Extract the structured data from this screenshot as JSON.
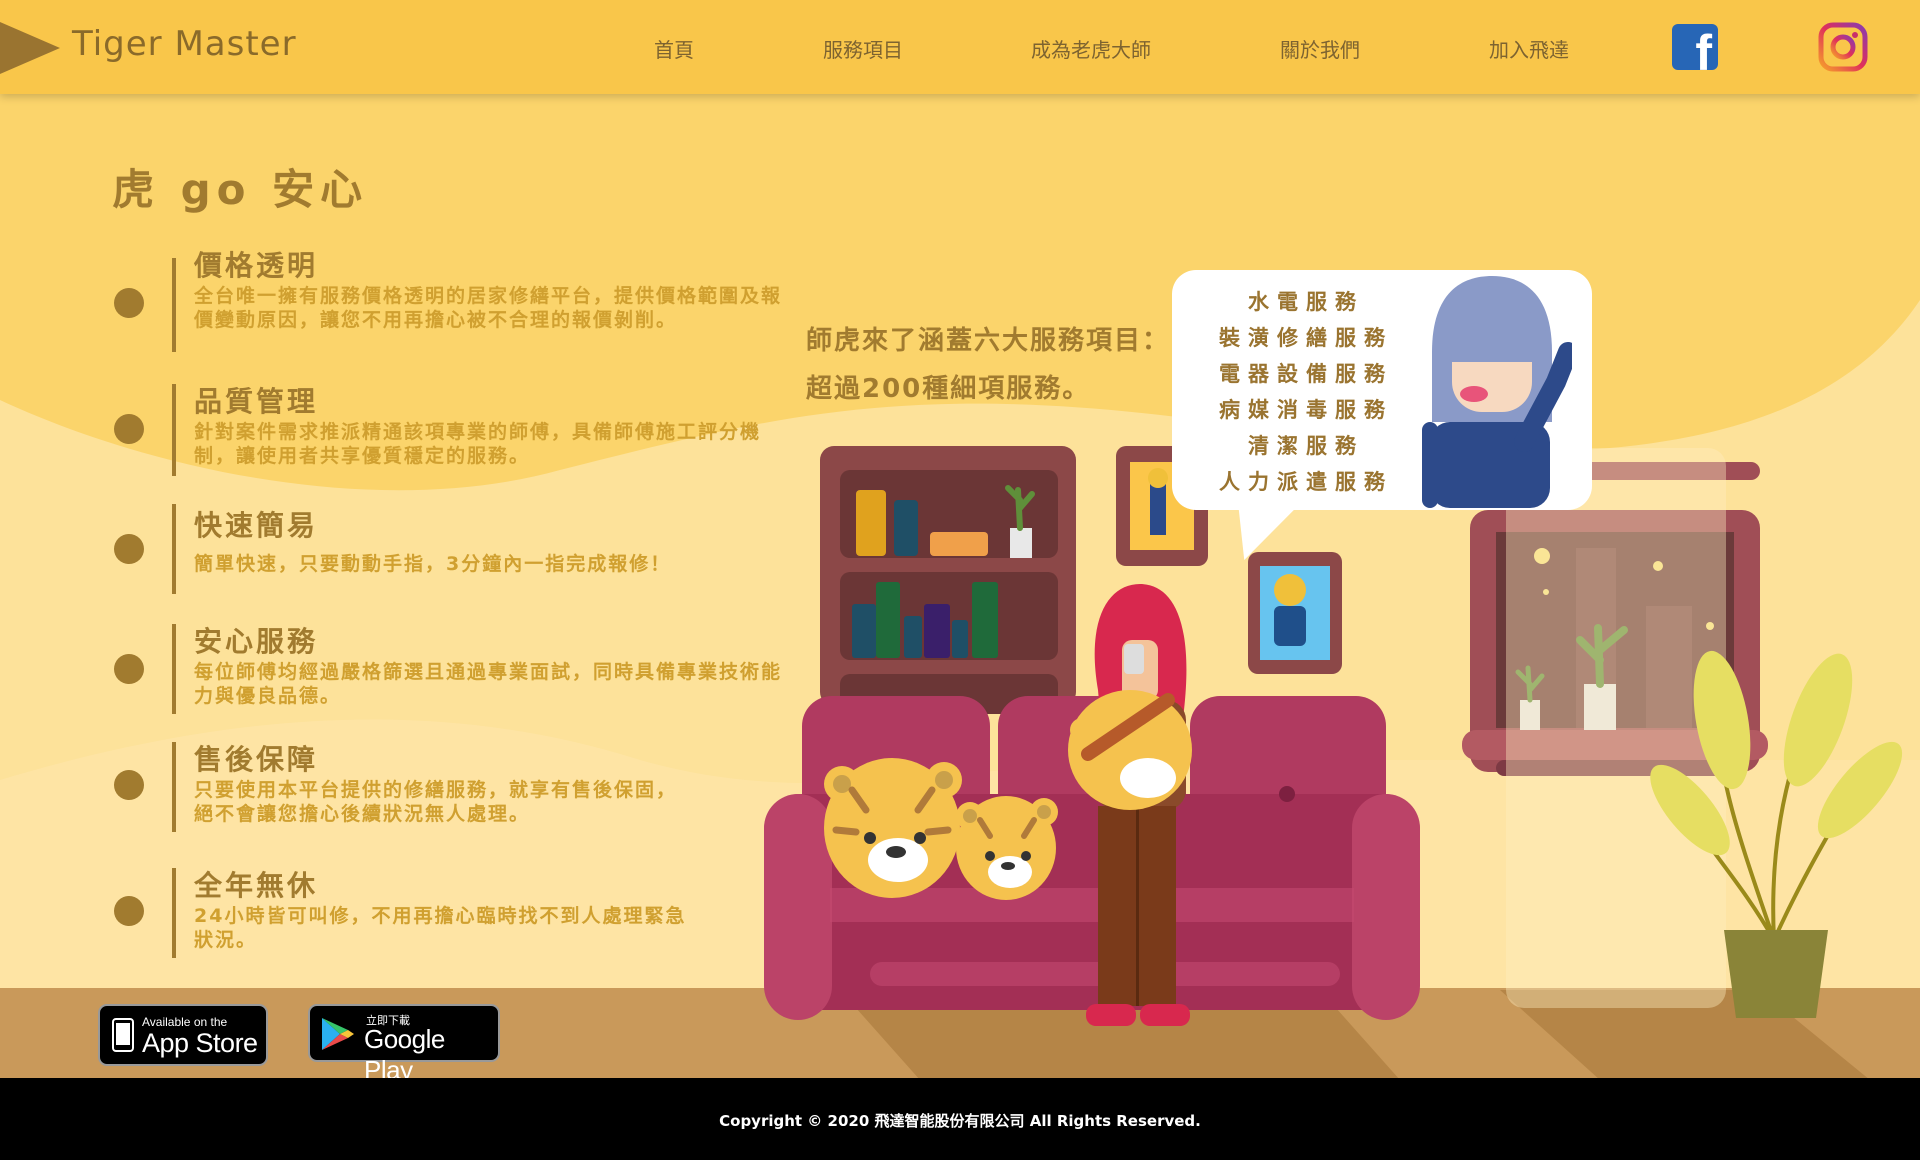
{
  "brand": {
    "logo_text": "Tiger Master"
  },
  "nav": {
    "items": [
      {
        "label": "首頁"
      },
      {
        "label": "服務項目"
      },
      {
        "label": "成為老虎大師"
      },
      {
        "label": "關於我們"
      },
      {
        "label": "加入飛達"
      }
    ],
    "social": [
      {
        "name": "facebook-icon"
      },
      {
        "name": "instagram-icon"
      }
    ]
  },
  "main": {
    "title": "虎 go 安心",
    "features": [
      {
        "title": "價格透明",
        "desc": "全台唯一擁有服務價格透明的居家修繕平台，提供價格範圍及報價變動原因，讓您不用再擔心被不合理的報價剝削。"
      },
      {
        "title": "品質管理",
        "desc": "針對案件需求推派精通該項專業的師傅，具備師傅施工評分機制，讓使用者共享優質穩定的服務。"
      },
      {
        "title": "快速簡易",
        "desc": "簡單快速，只要動動手指，3分鐘內一指完成報修！"
      },
      {
        "title": "安心服務",
        "desc": "每位師傅均經過嚴格篩選且通過專業面試，同時具備專業技術能力與優良品德。"
      },
      {
        "title": "售後保障",
        "desc": "只要使用本平台提供的修繕服務，就享有售後保固，絕不會讓您擔心後續狀況無人處理。"
      },
      {
        "title": "全年無休",
        "desc": "24小時皆可叫修，不用再擔心臨時找不到人處理緊急狀況。"
      }
    ],
    "service_intro": [
      "師虎來了涵蓋六大服務項目：",
      "超過200種細項服務。"
    ],
    "services": [
      "水電服務",
      "裝潢修繕服務",
      "電器設備服務",
      "病媒消毒服務",
      "清潔服務",
      "人力派遣服務"
    ]
  },
  "badges": {
    "appstore": {
      "small": "Available on the",
      "big": "App Store"
    },
    "googleplay": {
      "small": "立即下載",
      "big": "Google Play"
    }
  },
  "footer": {
    "copyright": "Copyright © 2020 飛達智能股份有限公司 All Rights Reserved."
  },
  "colors": {
    "header_bg": "#f9c64a",
    "page_bg": "#fbd46b",
    "accent_brown": "#a17b2f",
    "desc_gold": "#d0a030",
    "sofa": "#a32f55",
    "floor": "#c9995a",
    "footer_bg": "#000000"
  }
}
